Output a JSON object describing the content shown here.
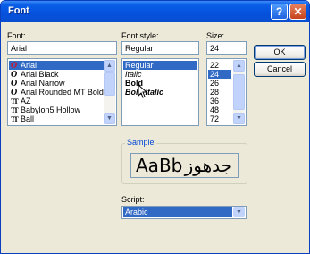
{
  "window": {
    "title": "Font",
    "help_label": "?",
    "close_label": "✕"
  },
  "font": {
    "label": "Font:",
    "value": "Arial",
    "items": [
      {
        "icon": "O",
        "name": "Arial"
      },
      {
        "icon": "O",
        "name": "Arial Black"
      },
      {
        "icon": "O",
        "name": "Arial Narrow"
      },
      {
        "icon": "O",
        "name": "Arial Rounded MT Bold"
      },
      {
        "icon": "TT",
        "name": "AZ"
      },
      {
        "icon": "TT",
        "name": "Babylon5 Hollow"
      },
      {
        "icon": "TT",
        "name": "Ball"
      }
    ]
  },
  "style": {
    "label": "Font style:",
    "value": "Regular",
    "items": [
      "Regular",
      "Italic",
      "Bold",
      "Bold Italic"
    ]
  },
  "size": {
    "label": "Size:",
    "value": "24",
    "items": [
      "22",
      "24",
      "26",
      "28",
      "36",
      "48",
      "72"
    ]
  },
  "buttons": {
    "ok": "OK",
    "cancel": "Cancel"
  },
  "sample": {
    "label": "Sample",
    "latin": "AaBb",
    "arabic": "جدهوز"
  },
  "script": {
    "label": "Script:",
    "value": "Arabic"
  },
  "icons": {
    "scroll_up": "▲",
    "scroll_down": "▼",
    "dropdown": "▼"
  }
}
